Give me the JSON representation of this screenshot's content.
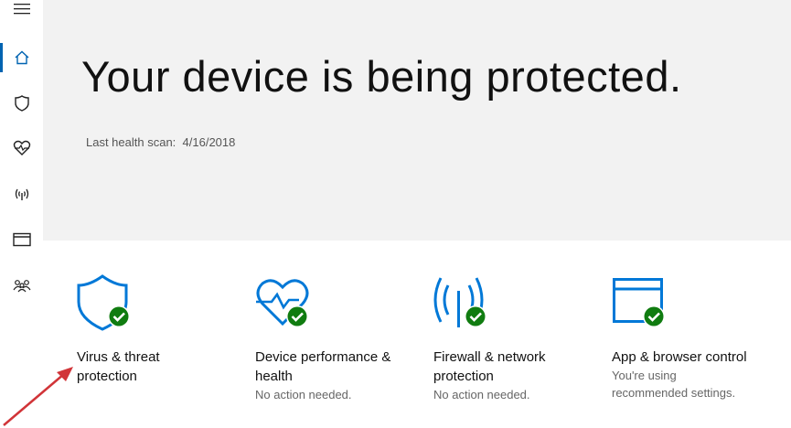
{
  "sidebar": {
    "items": [
      {
        "icon": "menu-icon"
      },
      {
        "icon": "home-icon",
        "active": true
      },
      {
        "icon": "shield-icon"
      },
      {
        "icon": "heart-pulse-icon"
      },
      {
        "icon": "antenna-icon"
      },
      {
        "icon": "browser-window-icon"
      },
      {
        "icon": "family-icon"
      }
    ]
  },
  "hero": {
    "title": "Your device is being protected.",
    "scan_label": "Last health scan:",
    "scan_date": "4/16/2018"
  },
  "tiles": [
    {
      "icon": "shield-check-icon",
      "label_line1": "Virus & threat",
      "label_line2": "protection",
      "status": ""
    },
    {
      "icon": "heart-check-icon",
      "label_line1": "Device performance &",
      "label_line2": "health",
      "status": "No action needed."
    },
    {
      "icon": "antenna-check-icon",
      "label_line1": "Firewall & network",
      "label_line2": "protection",
      "status": "No action needed."
    },
    {
      "icon": "window-check-icon",
      "label_line1": "App & browser control",
      "label_line2": "",
      "status_line1": "You're using",
      "status_line2": "recommended settings."
    }
  ],
  "colors": {
    "accent": "#0078d7",
    "ok": "#107c10",
    "hero_bg": "#f2f2f2",
    "annotation_arrow": "#d13438"
  }
}
